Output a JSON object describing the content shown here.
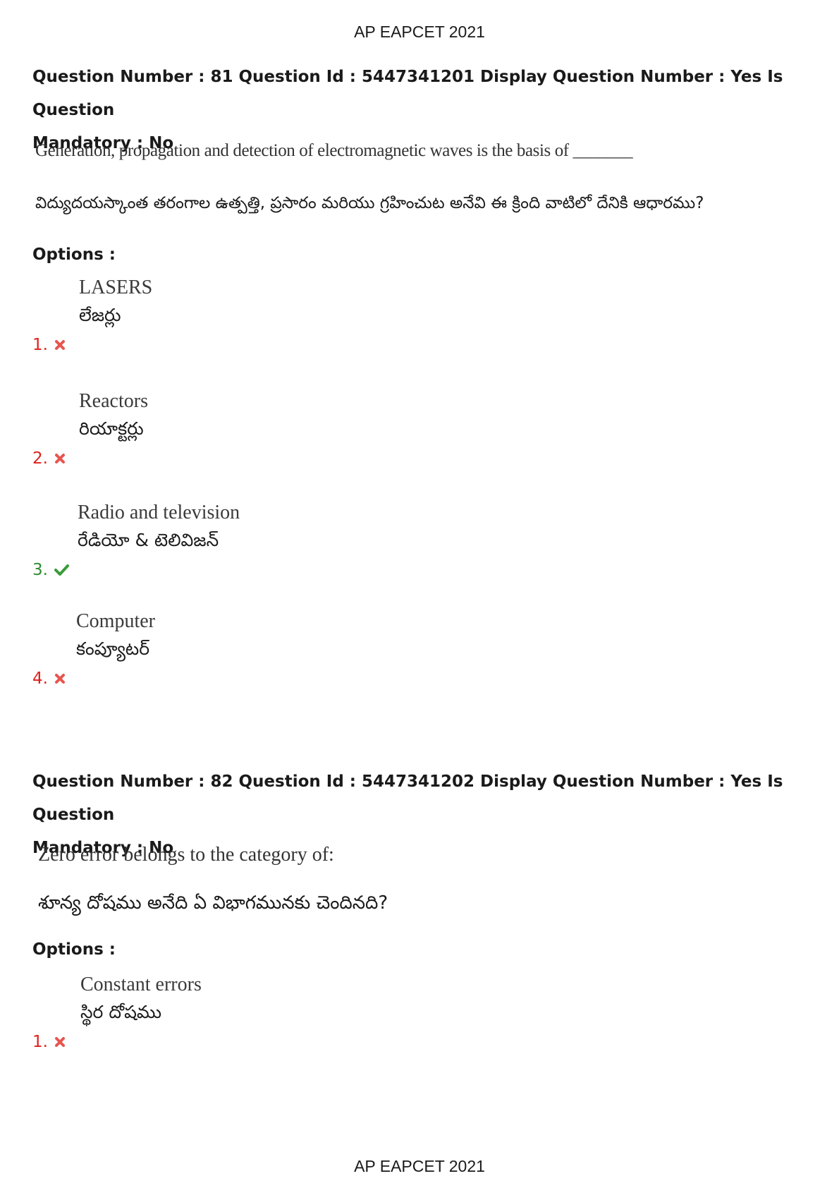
{
  "header": {
    "title": "AP EAPCET 2021"
  },
  "footer": {
    "title": "AP EAPCET 2021"
  },
  "questions": [
    {
      "meta_line1": "Question Number : 81 Question Id : 5447341201 Display Question Number : Yes Is Question",
      "meta_line2": "Mandatory : No",
      "text_en": "Generation, propagation and detection of electromagnetic waves is the basis of _______",
      "text_te": "విద్యుదయస్కాంత తరంగాల ఉత్పత్తి, ప్రసారం మరియు గ్రహించుట అనేవి ఈ క్రింది వాటిలో దేనికి ఆధారము?",
      "options_label": "Options :",
      "options": [
        {
          "number": "1.",
          "en": "LASERS",
          "te": "లేజర్లు",
          "status": "wrong",
          "mark_icon": "cross-icon"
        },
        {
          "number": "2.",
          "en": "Reactors",
          "te": "రియాక్టర్లు",
          "status": "wrong",
          "mark_icon": "cross-icon"
        },
        {
          "number": "3.",
          "en": "Radio and television",
          "te": "రేడియో & టెలివిజన్",
          "status": "right",
          "mark_icon": "check-icon"
        },
        {
          "number": "4.",
          "en": "Computer",
          "te": "కంప్యూటర్",
          "status": "wrong",
          "mark_icon": "cross-icon"
        }
      ]
    },
    {
      "meta_line1": "Question Number : 82 Question Id : 5447341202 Display Question Number : Yes Is Question",
      "meta_line2": "Mandatory : No",
      "text_en": "Zero error belongs to the category of:",
      "text_te": "శూన్య దోషము అనేది ఏ విభాగమునకు చెందినది?",
      "options_label": "Options :",
      "options": [
        {
          "number": "1.",
          "en": "Constant errors",
          "te": "స్థిర దోషము",
          "status": "wrong",
          "mark_icon": "cross-icon"
        }
      ]
    }
  ],
  "colors": {
    "wrong": "#e0201c",
    "right": "#2e8b2e"
  }
}
